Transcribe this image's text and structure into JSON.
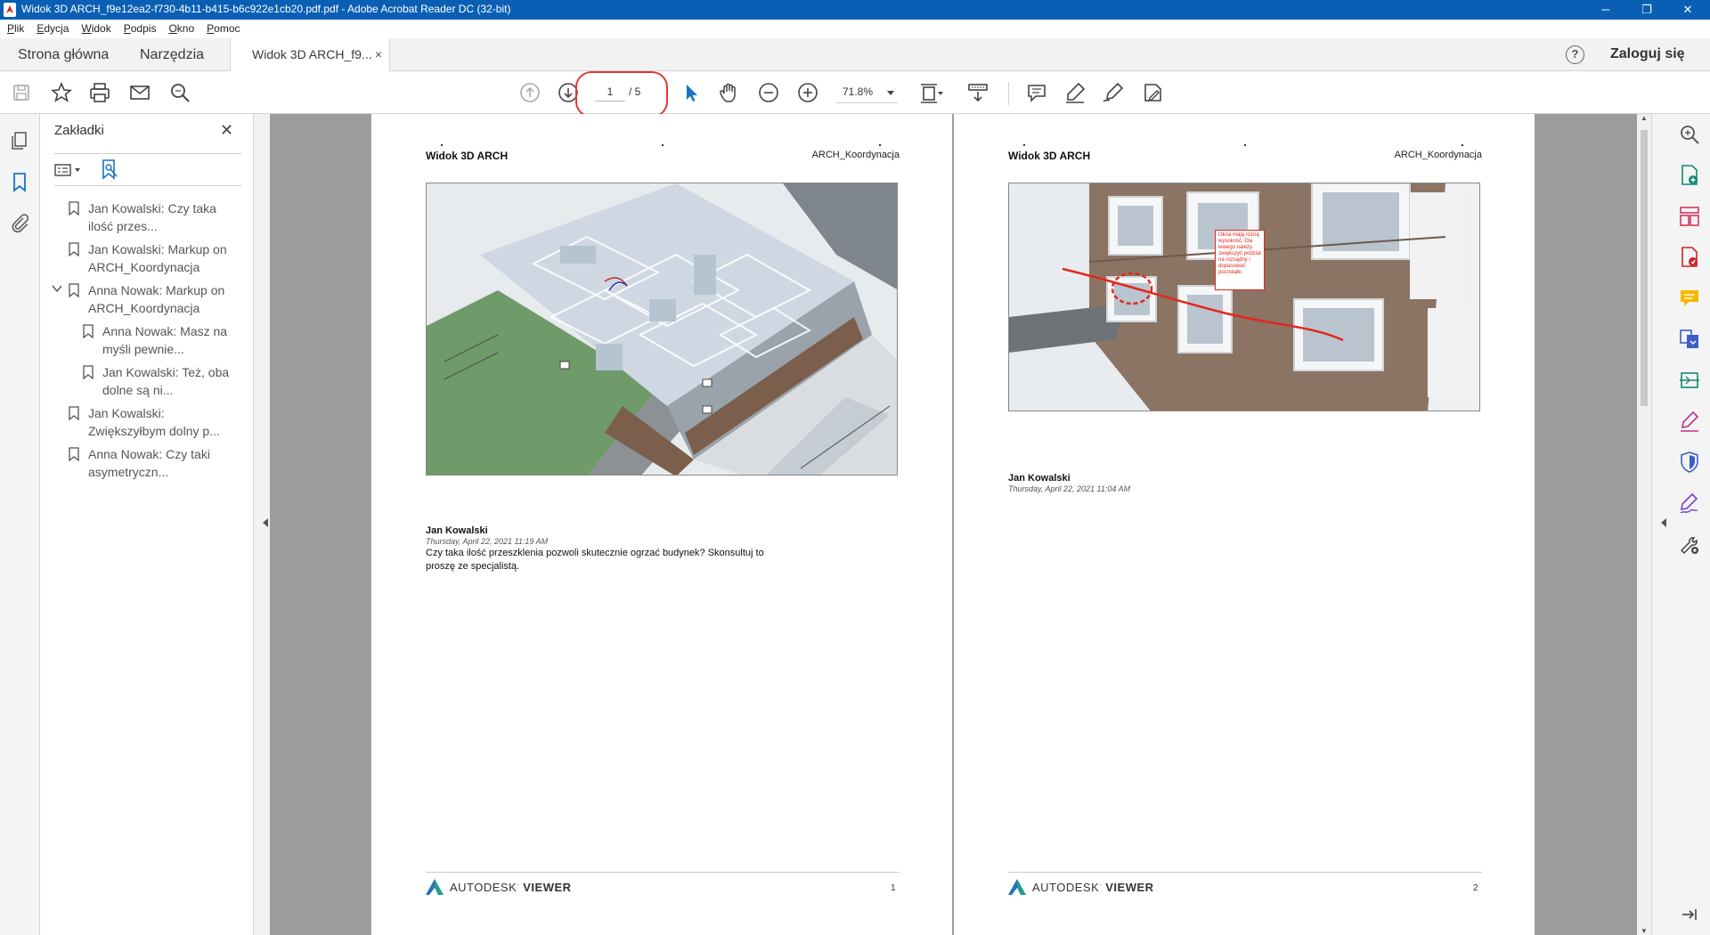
{
  "window": {
    "title": "Widok 3D ARCH_f9e12ea2-f730-4b11-b415-b6c922e1cb20.pdf.pdf - Adobe Acrobat Reader DC (32-bit)",
    "minimize": "─",
    "restore": "❐",
    "close": "✕"
  },
  "menu": {
    "items": [
      {
        "first": "P",
        "rest": "lik"
      },
      {
        "first": "E",
        "rest": "dycja"
      },
      {
        "first": "W",
        "rest": "idok"
      },
      {
        "first": "P",
        "rest": "odpis"
      },
      {
        "first": "O",
        "rest": "kno"
      },
      {
        "first": "P",
        "rest": "omoc"
      }
    ]
  },
  "tabs": {
    "home": "Strona główna",
    "tools": "Narzędzia",
    "document": "Widok 3D ARCH_f9...",
    "document_close": "×"
  },
  "header": {
    "help": "?",
    "signin": "Zaloguj się"
  },
  "toolbar": {
    "page_current": "1",
    "page_total": "/ 5",
    "zoom": "71.8%"
  },
  "bookmarks": {
    "title": "Zakładki",
    "close": "✕",
    "items": [
      {
        "label": "Jan Kowalski: Czy taka ilość przes..."
      },
      {
        "label": "Jan Kowalski: Markup on ARCH_Koordynacja"
      },
      {
        "label": "Anna Nowak: Markup on ARCH_Koordynacja",
        "expanded": true
      },
      {
        "label": "Anna Nowak: Masz na myśli pewnie..."
      },
      {
        "label": "Jan Kowalski: Też, oba dolne są ni..."
      },
      {
        "label": "Jan Kowalski: Zwiększyłbym dolny p..."
      },
      {
        "label": "Anna Nowak: Czy taki asymetryczn..."
      }
    ]
  },
  "pages": [
    {
      "title": "Widok 3D ARCH",
      "project": "ARCH_Koordynacja",
      "author": "Jan Kowalski",
      "date": "Thursday, April 22, 2021 11:19 AM",
      "comment": "Czy taka ilość przeszklenia pozwoli skutecznie ogrzać budynek? Skonsultuj to proszę ze specjalistą.",
      "brand": "AUTODESK",
      "brand_suffix": "VIEWER",
      "number": "1"
    },
    {
      "title": "Widok 3D ARCH",
      "project": "ARCH_Koordynacja",
      "author": "Jan Kowalski",
      "date": "Thursday, April 22, 2021 11:04 AM",
      "markup_note": "Okna mają różną wysokość. Dla lewego należy zwiększyć podział na rozsądny i dopasować pozostałe.",
      "brand": "AUTODESK",
      "brand_suffix": "VIEWER",
      "number": "2"
    }
  ]
}
